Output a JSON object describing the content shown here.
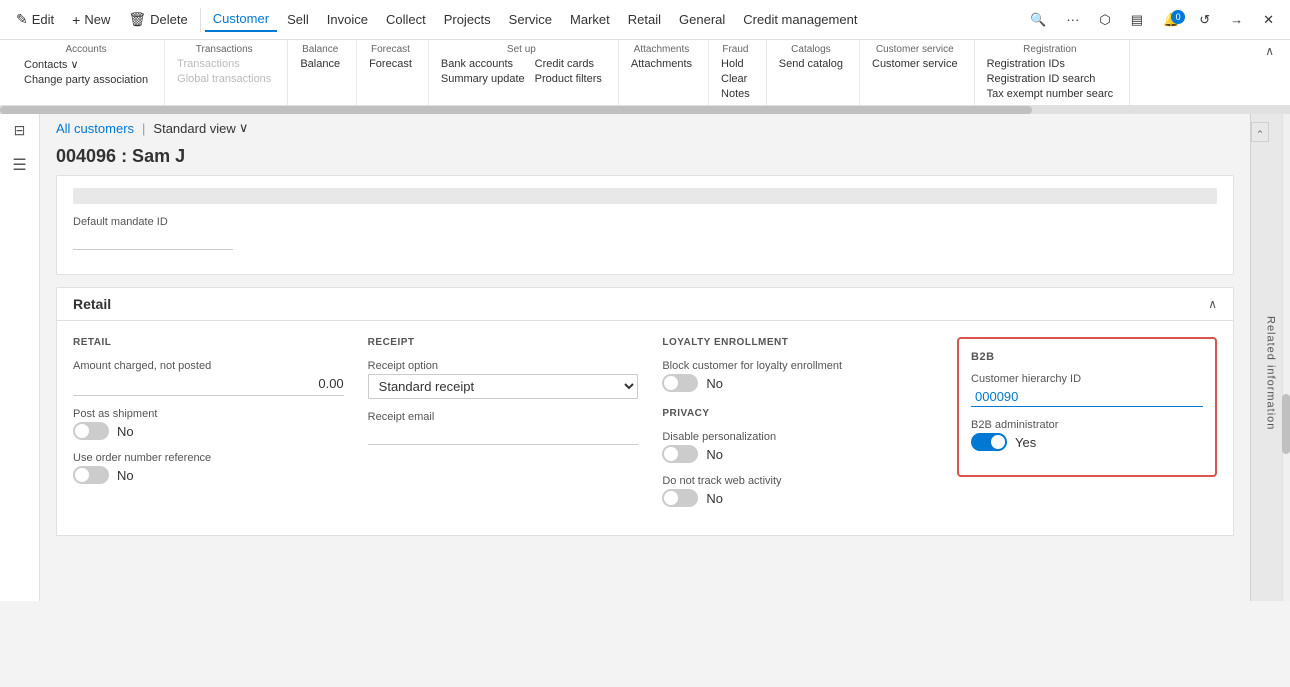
{
  "toolbar": {
    "edit": "Edit",
    "new": "New",
    "delete": "Delete",
    "customer": "Customer",
    "sell": "Sell",
    "invoice": "Invoice",
    "collect": "Collect",
    "projects": "Projects",
    "service": "Service",
    "market": "Market",
    "retail": "Retail",
    "general": "General",
    "credit_management": "Credit management"
  },
  "ribbon": {
    "accounts": {
      "title": "Accounts",
      "contacts": "Contacts",
      "change_party": "Change party association"
    },
    "transactions": {
      "title": "Transactions",
      "transactions": "Transactions",
      "global": "Global transactions"
    },
    "balance": {
      "title": "Balance",
      "balance": "Balance"
    },
    "forecast": {
      "title": "Forecast",
      "forecast": "Forecast"
    },
    "setup": {
      "title": "Set up",
      "bank_accounts": "Bank accounts",
      "summary_update": "Summary update",
      "credit_cards": "Credit cards",
      "product_filters": "Product filters"
    },
    "attachments": {
      "title": "Attachments",
      "attachments": "Attachments"
    },
    "fraud": {
      "title": "Fraud",
      "hold": "Hold",
      "clear": "Clear",
      "notes": "Notes"
    },
    "catalogs": {
      "title": "Catalogs",
      "send_catalog": "Send catalog"
    },
    "customer_service": {
      "title": "Customer service",
      "customer_service": "Customer service"
    },
    "registration": {
      "title": "Registration",
      "registration_ids": "Registration IDs",
      "registration_id_search": "Registration ID search",
      "tax_exempt": "Tax exempt number searc"
    }
  },
  "breadcrumb": {
    "all_customers": "All customers",
    "separator": "|",
    "standard_view": "Standard view"
  },
  "page": {
    "title": "004096 : Sam J"
  },
  "default_mandate": {
    "label": "Default mandate ID"
  },
  "retail_section": {
    "title": "Retail",
    "retail_col": "RETAIL",
    "amount_label": "Amount charged, not posted",
    "amount_value": "0.00",
    "post_shipment_label": "Post as shipment",
    "post_shipment_value": "No",
    "order_number_label": "Use order number reference",
    "order_number_value": "No",
    "receipt_col": "RECEIPT",
    "receipt_option_label": "Receipt option",
    "receipt_option_value": "Standard receipt",
    "receipt_email_label": "Receipt email",
    "loyalty_col": "LOYALTY ENROLLMENT",
    "block_loyalty_label": "Block customer for loyalty enrollment",
    "block_loyalty_value": "No",
    "privacy_col": "PRIVACY",
    "disable_personalization_label": "Disable personalization",
    "disable_personalization_value": "No",
    "do_not_track_label": "Do not track web activity",
    "do_not_track_value": "No",
    "b2b_col": "B2B",
    "customer_hierarchy_label": "Customer hierarchy ID",
    "customer_hierarchy_value": "000090",
    "b2b_admin_label": "B2B administrator",
    "b2b_admin_value": "Yes"
  },
  "right_panel": {
    "label": "Related information"
  }
}
